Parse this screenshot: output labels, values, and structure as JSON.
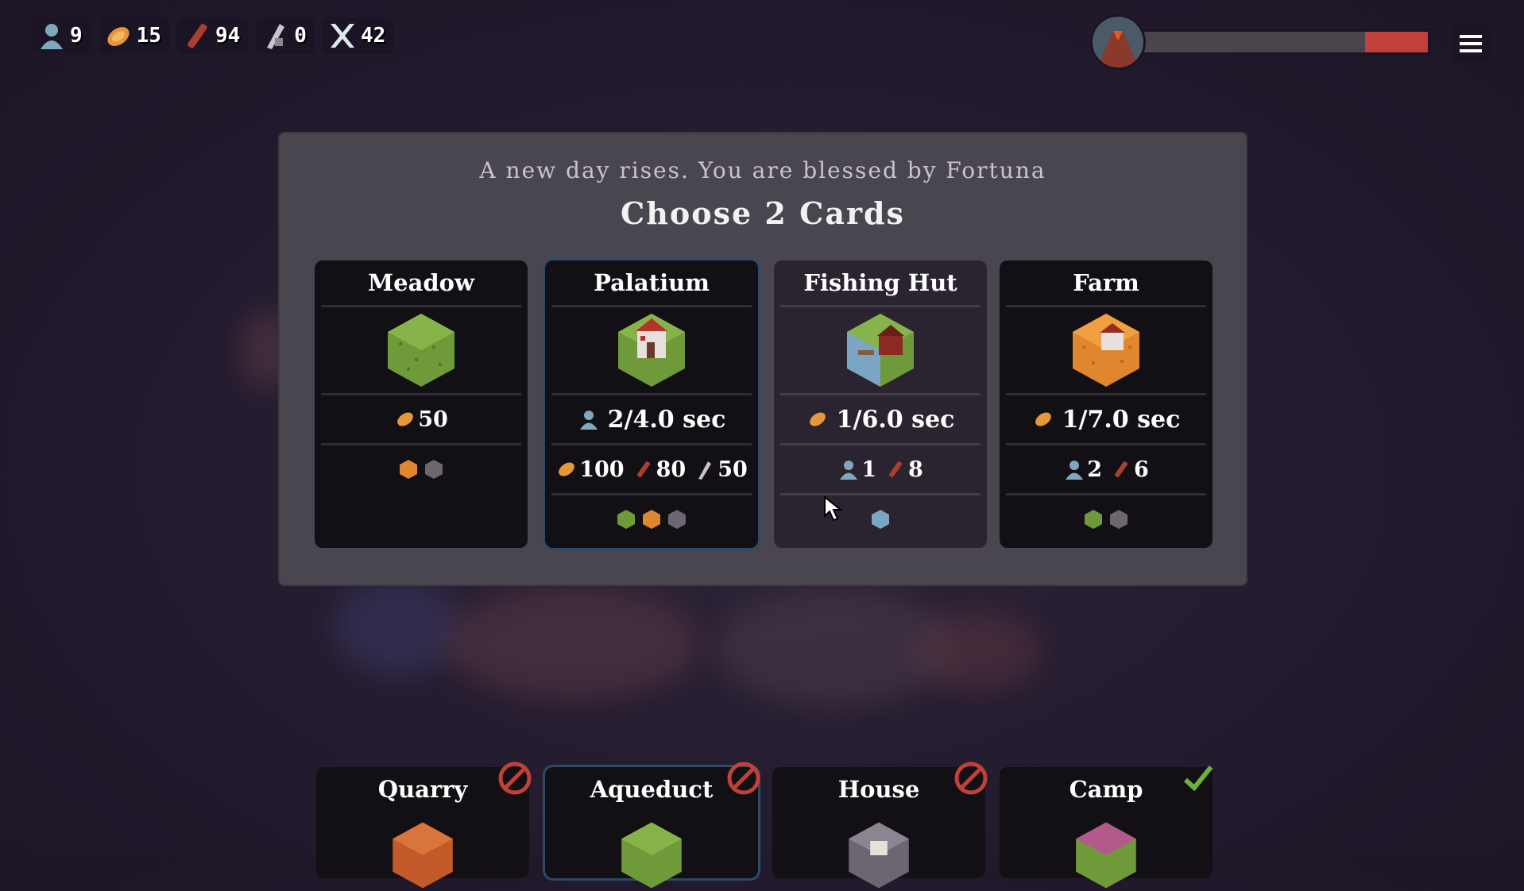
{
  "hud": {
    "resources": [
      {
        "icon": "population-icon",
        "value": "9"
      },
      {
        "icon": "food-icon",
        "value": "15"
      },
      {
        "icon": "wood-icon",
        "value": "94"
      },
      {
        "icon": "stone-icon",
        "value": "0"
      },
      {
        "icon": "day-counter-icon",
        "value": "42"
      }
    ],
    "health_fraction": 0.22
  },
  "dialog": {
    "subtitle": "A new day rises. You are blessed by Fortuna",
    "title": "Choose 2 Cards"
  },
  "cards": [
    {
      "name": "Meadow",
      "cost_food": "50"
    },
    {
      "name": "Palatium",
      "production": "2/4.0 sec",
      "cost_food": "100",
      "cost_wood": "80",
      "cost_stone": "50"
    },
    {
      "name": "Fishing Hut",
      "production": "1/6.0 sec",
      "cost_pop": "1",
      "cost_wood": "8"
    },
    {
      "name": "Farm",
      "production": "1/7.0 sec",
      "cost_pop": "2",
      "cost_wood": "6"
    }
  ],
  "hand": [
    {
      "name": "Quarry",
      "status": "blocked"
    },
    {
      "name": "Aqueduct",
      "status": "blocked"
    },
    {
      "name": "House",
      "status": "blocked"
    },
    {
      "name": "Camp",
      "status": "available"
    }
  ],
  "colors": {
    "health": "#c2403a",
    "grass": "#6f9a3a",
    "field": "#e0862e",
    "stone": "#6b6670",
    "water": "#7aa6c4"
  }
}
